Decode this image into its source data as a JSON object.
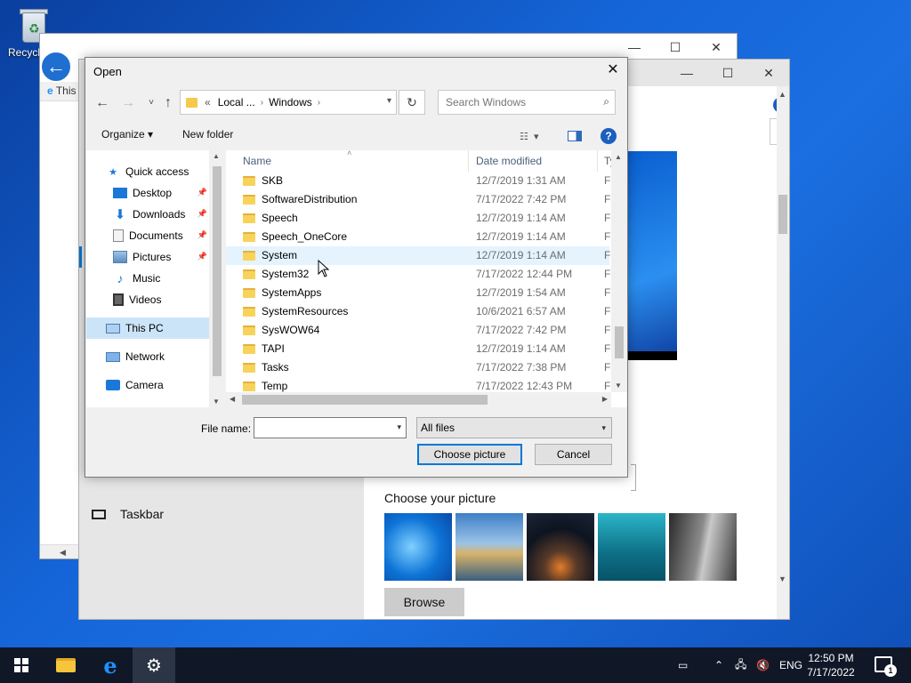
{
  "desktop": {
    "recycle_bin_label": "Recycl"
  },
  "ie_window": {
    "tab_text": "This"
  },
  "settings": {
    "taskbar_label": "Taskbar",
    "choose_picture_title": "Choose your picture",
    "browse_label": "Browse"
  },
  "dialog": {
    "title": "Open",
    "address": {
      "segments": [
        "Local ...",
        "Windows"
      ],
      "overflow": "«"
    },
    "search_placeholder": "Search Windows",
    "toolbar": {
      "organize": "Organize ▾",
      "new_folder": "New folder"
    },
    "nav": [
      {
        "label": "Quick access",
        "icon": "star-icon",
        "pinned": false
      },
      {
        "label": "Desktop",
        "icon": "desktop-icon",
        "pinned": true
      },
      {
        "label": "Downloads",
        "icon": "download-icon",
        "pinned": true
      },
      {
        "label": "Documents",
        "icon": "documents-icon",
        "pinned": true
      },
      {
        "label": "Pictures",
        "icon": "pictures-icon",
        "pinned": true
      },
      {
        "label": "Music",
        "icon": "music-icon",
        "pinned": false
      },
      {
        "label": "Videos",
        "icon": "videos-icon",
        "pinned": false
      },
      {
        "label": "This PC",
        "icon": "computer-icon",
        "pinned": false
      },
      {
        "label": "Network",
        "icon": "network-icon",
        "pinned": false
      },
      {
        "label": "Camera",
        "icon": "camera-icon",
        "pinned": false
      }
    ],
    "columns": {
      "name": "Name",
      "date": "Date modified",
      "type": "Ty"
    },
    "files": [
      {
        "name": "SKB",
        "date": "12/7/2019 1:31 AM",
        "type": "Fi"
      },
      {
        "name": "SoftwareDistribution",
        "date": "7/17/2022 7:42 PM",
        "type": "Fi"
      },
      {
        "name": "Speech",
        "date": "12/7/2019 1:14 AM",
        "type": "Fi"
      },
      {
        "name": "Speech_OneCore",
        "date": "12/7/2019 1:14 AM",
        "type": "Fi"
      },
      {
        "name": "System",
        "date": "12/7/2019 1:14 AM",
        "type": "Fi"
      },
      {
        "name": "System32",
        "date": "7/17/2022 12:44 PM",
        "type": "Fi"
      },
      {
        "name": "SystemApps",
        "date": "12/7/2019 1:54 AM",
        "type": "Fi"
      },
      {
        "name": "SystemResources",
        "date": "10/6/2021 6:57 AM",
        "type": "Fi"
      },
      {
        "name": "SysWOW64",
        "date": "7/17/2022 7:42 PM",
        "type": "Fi"
      },
      {
        "name": "TAPI",
        "date": "12/7/2019 1:14 AM",
        "type": "Fi"
      },
      {
        "name": "Tasks",
        "date": "7/17/2022 7:38 PM",
        "type": "Fi"
      },
      {
        "name": "Temp",
        "date": "7/17/2022 12:43 PM",
        "type": "Fi"
      }
    ],
    "hovered_row": "System",
    "file_name_label": "File name:",
    "file_name_value": "",
    "file_type": "All files",
    "open_label": "Choose picture",
    "cancel_label": "Cancel"
  },
  "taskbar": {
    "language": "ENG",
    "time": "12:50 PM",
    "date": "7/17/2022",
    "notification_count": "1"
  },
  "colors": {
    "accent": "#0078d7",
    "taskbar": "#101827",
    "desktop": "#1565d8"
  }
}
